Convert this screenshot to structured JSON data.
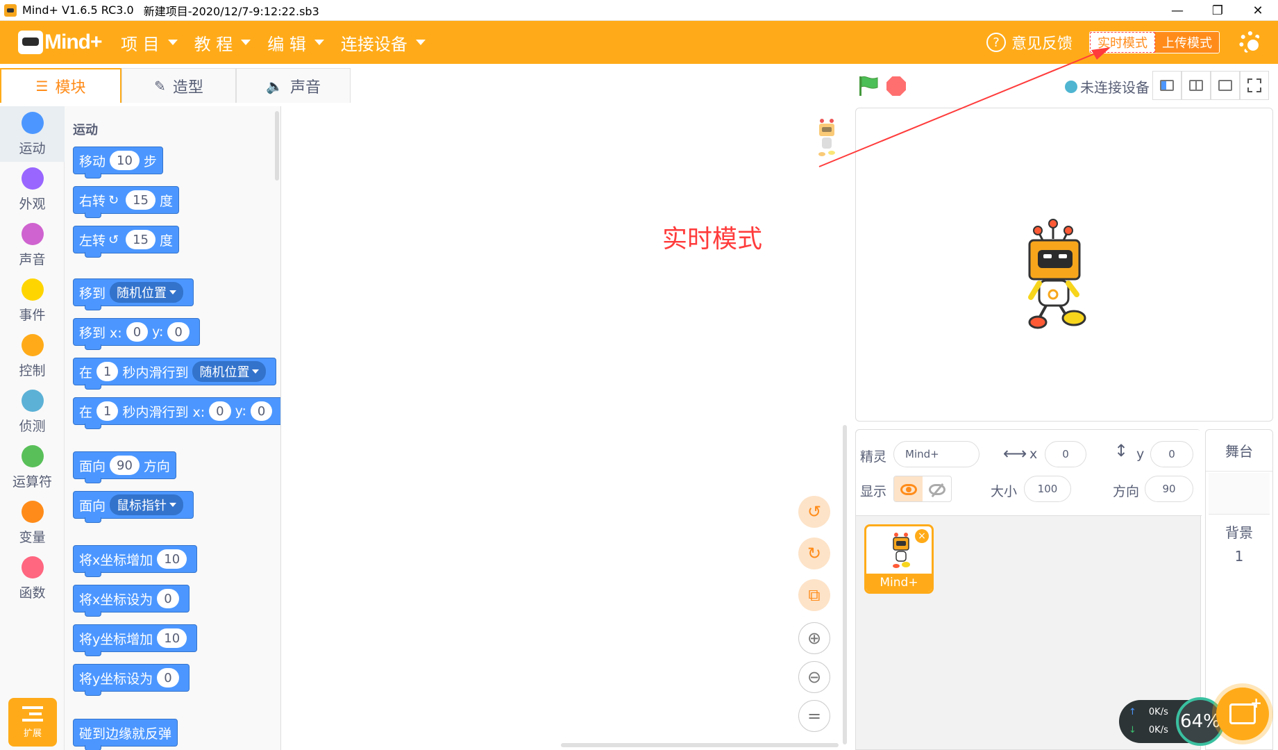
{
  "window": {
    "title": "Mind+ V1.6.5 RC3.0",
    "file": "新建项目-2020/12/7-9:12:22.sb3",
    "minimize": "—",
    "maximize": "❐",
    "close": "✕"
  },
  "menubar": {
    "logo_text": "Mind+",
    "items": [
      "项 目",
      "教 程",
      "编 辑",
      "连接设备"
    ],
    "feedback": "意见反馈",
    "mode_realtime": "实时模式",
    "mode_upload": "上传模式"
  },
  "tabs": [
    "模块",
    "造型",
    "声音"
  ],
  "categories": [
    {
      "label": "运动",
      "color": "#4c97ff"
    },
    {
      "label": "外观",
      "color": "#9966ff"
    },
    {
      "label": "声音",
      "color": "#cf63cf"
    },
    {
      "label": "事件",
      "color": "#ffd500"
    },
    {
      "label": "控制",
      "color": "#ffab19"
    },
    {
      "label": "侦测",
      "color": "#5cb1d6"
    },
    {
      "label": "运算符",
      "color": "#59c059"
    },
    {
      "label": "变量",
      "color": "#ff8c1a"
    },
    {
      "label": "函数",
      "color": "#ff6680"
    }
  ],
  "extension_label": "扩展",
  "palette": {
    "section": "运动",
    "blocks": {
      "move": {
        "a": "移动",
        "n": "10",
        "b": "步"
      },
      "turn_right": {
        "a": "右转",
        "sym": "↻",
        "n": "15",
        "b": "度"
      },
      "turn_left": {
        "a": "左转",
        "sym": "↺",
        "n": "15",
        "b": "度"
      },
      "goto_menu": {
        "a": "移到",
        "d": "随机位置"
      },
      "goto_xy": {
        "a": "移到 x:",
        "x": "0",
        "b": "y:",
        "y": "0"
      },
      "glide_menu": {
        "a": "在",
        "n": "1",
        "b": "秒内滑行到",
        "d": "随机位置"
      },
      "glide_xy": {
        "a": "在",
        "n": "1",
        "b": "秒内滑行到 x:",
        "x": "0",
        "c": "y:",
        "y": "0"
      },
      "point_dir": {
        "a": "面向",
        "n": "90",
        "b": "方向"
      },
      "point_towards": {
        "a": "面向",
        "d": "鼠标指针"
      },
      "change_x": {
        "a": "将x坐标增加",
        "n": "10"
      },
      "set_x": {
        "a": "将x坐标设为",
        "n": "0"
      },
      "change_y": {
        "a": "将y坐标增加",
        "n": "10"
      },
      "set_y": {
        "a": "将y坐标设为",
        "n": "0"
      },
      "bounce": {
        "a": "碰到边缘就反弹"
      }
    }
  },
  "annotation": "实时模式",
  "stage_header": {
    "connection": "未连接设备"
  },
  "sprite_info": {
    "sprite_label": "精灵",
    "sprite_name": "Mind+",
    "x_label": "x",
    "x": "0",
    "y_label": "y",
    "y": "0",
    "show_label": "显示",
    "size_label": "大小",
    "size": "100",
    "direction_label": "方向",
    "direction": "90"
  },
  "sprites": [
    {
      "name": "Mind+",
      "delete": "×"
    }
  ],
  "stage_selector": {
    "header": "舞台",
    "backdrop_label": "背景",
    "backdrop_count": "1"
  },
  "network": {
    "up": "0K/s",
    "down": "0K/s",
    "cpu": "64%"
  },
  "colors": {
    "accent": "#ffab19",
    "motion": "#4c97ff",
    "annotation": "#ff3b3b"
  }
}
